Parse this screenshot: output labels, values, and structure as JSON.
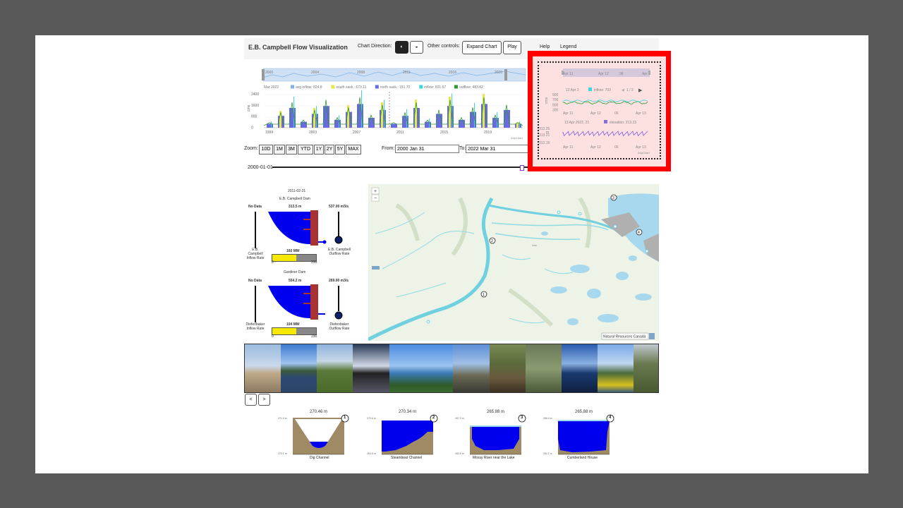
{
  "header": {
    "title": "E.B. Campbell Flow Visualization",
    "chart_direction_label": "Chart Direction:",
    "other_controls_label": "Other controls:",
    "expand_chart": "Expand Chart",
    "play": "Play",
    "help": "Help",
    "legend": "Legend"
  },
  "main_chart": {
    "navigator_years": [
      "2000",
      "2004",
      "2008",
      "2011",
      "2016",
      "2020"
    ],
    "legend": {
      "date": "Mar 2022",
      "avg_inflow": "avg inflow: 824.8",
      "south_sask": "south sask.: 673.11",
      "north_sask": "north sask.: 151.70",
      "inflow": "inflow: 601.67",
      "outflow": "outflow: 483.82"
    },
    "y_label": "cms",
    "y_ticks": [
      "2400",
      "1600",
      "800",
      "0"
    ],
    "x_ticks": [
      "1999",
      "2003",
      "2007",
      "2011",
      "2015",
      "2019"
    ],
    "credit": "AnyChart",
    "colors": {
      "avg_inflow": "#7fb3e8",
      "south_sask": "#e8e84a",
      "north_sask": "#6a6ae0",
      "inflow": "#3ad6e0",
      "outflow": "#2c9a2c"
    }
  },
  "zoom": {
    "label": "Zoom:",
    "buttons": [
      "10D",
      "1M",
      "3M",
      "YTD",
      "1Y",
      "2Y",
      "5Y",
      "MAX"
    ],
    "from_label": "From:",
    "from_value": "2000 Jan 31",
    "to_label": "To:",
    "to_value": "2022 Mar 31"
  },
  "timeline": {
    "date": "2000-01-01"
  },
  "mini_chart": {
    "nav_ticks": [
      "Apr 11",
      "Apr 12",
      "06",
      "Apr"
    ],
    "tooltip_date": "12 Apr 2",
    "tooltip_value": "inflow: 703",
    "pager": "1 / 2",
    "y_label": "cms",
    "y_ticks": [
      "900",
      "700",
      "500",
      "300"
    ],
    "x_ticks": [
      "Apr 11",
      "Apr 12",
      "06",
      "Apr 13"
    ],
    "elev_date": "13 Apr 2022, 21",
    "elev_value": "elevation: 313.23",
    "elev_y_label": "m",
    "elev_ticks": [
      "313.25",
      "313.21",
      "313.19"
    ],
    "elev_x_ticks": [
      "Apr 11",
      "Apr 12",
      "06",
      "Apr 13"
    ],
    "credit": "AnyChart"
  },
  "dams": {
    "date": "2011-02-21",
    "campbell": {
      "name": "E.B. Campbell Dam",
      "inflow_value": "No Data",
      "elevation": "313.5 m",
      "outflow_value": "537.00 m3/s",
      "power": "160 MW",
      "power_min": "0",
      "power_max": "290",
      "inflow_label": "E.B. Campbell Inflow Rate",
      "outflow_label": "E.B. Campbell Outflow Rate",
      "power_fraction": 0.55
    },
    "gardiner": {
      "name": "Gardiner Dam",
      "inflow_value": "No Data",
      "elevation": "554.2 m",
      "outflow_value": "269.00 m3/s",
      "power": "104 MW",
      "power_min": "0",
      "power_max": "190",
      "inflow_label": "Diefenbaker Inflow Rate",
      "outflow_label": "Diefenbaker Outflow Rate",
      "power_fraction": 0.55
    }
  },
  "map": {
    "zoom_in": "+",
    "zoom_out": "−",
    "attribution": "Natural Resources Canada",
    "markers": [
      "1",
      "2",
      "3",
      "4"
    ],
    "place_label": "Arm"
  },
  "gallery": {
    "prev": "<",
    "next": ">"
  },
  "cross_sections": [
    {
      "num": "1",
      "level": "270.46 m",
      "top": "271.0 m",
      "bottom": "270.1 m",
      "name": "Dig Channel"
    },
    {
      "num": "2",
      "level": "270.34 m",
      "top": "270.6 m",
      "bottom": "264.6 m",
      "name": "Steamboat Channel"
    },
    {
      "num": "3",
      "level": "265.88 m",
      "top": "267.3 m",
      "bottom": "260.5 m",
      "name": "Mossy River near the Lake"
    },
    {
      "num": "4",
      "level": "265.88 m",
      "top": "266.0 m",
      "bottom": "261.2 m",
      "name": "Cumberland House"
    }
  ]
}
